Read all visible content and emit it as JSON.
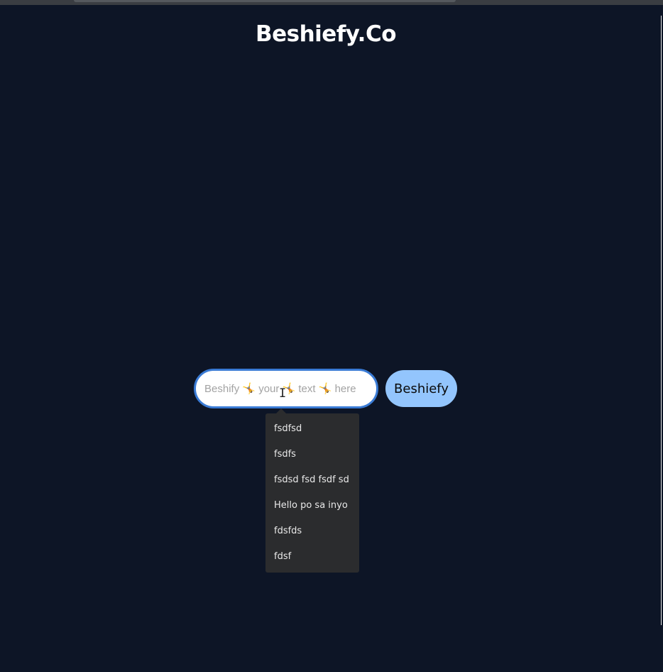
{
  "header": {
    "title": "Beshiefy.Co"
  },
  "form": {
    "input_value": "",
    "input_placeholder": "Beshify 🤸 your 🤸 text 🤸 here",
    "submit_label": "Beshiefy"
  },
  "autocomplete": {
    "items": [
      "fsdfsd",
      "fsdfs",
      "fsdsd fsd fsdf sd",
      "Hello po sa inyo",
      "fdsfds",
      "fdsf"
    ]
  },
  "colors": {
    "background": "#0d1526",
    "title": "#ffffff",
    "input_border": "#3a7bd5",
    "button_bg": "#93c5fd",
    "dropdown_bg": "#2b2c2e"
  }
}
